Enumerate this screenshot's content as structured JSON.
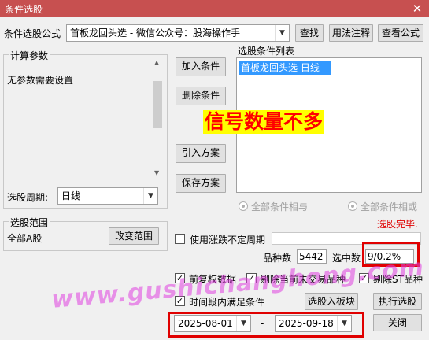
{
  "window": {
    "title": "条件选股",
    "close": "✕"
  },
  "formula": {
    "label": "条件选股公式",
    "value": "首板龙回头选  -  微信公众号：股海操作手",
    "buttons": {
      "find": "查找",
      "usage": "用法注释",
      "view": "查看公式"
    }
  },
  "params": {
    "group_title": "计算参数",
    "text": "无参数需要设置"
  },
  "period": {
    "label": "选股周期:",
    "value": "日线"
  },
  "range": {
    "group_title": "选股范围",
    "value": "全部A股",
    "change_button": "改变范围"
  },
  "actions": {
    "add": "加入条件",
    "delete": "删除条件",
    "import": "引入方案",
    "save": "保存方案"
  },
  "conditions": {
    "title": "选股条件列表",
    "items": [
      "首板龙回头选  日线"
    ]
  },
  "overlay_text": "信号数量不多",
  "logic": {
    "and": "全部条件相与",
    "or": "全部条件相或"
  },
  "status": "选股完毕.",
  "uncertain_period": {
    "label": "使用涨跌不定周期",
    "checked": false
  },
  "counts": {
    "total_label": "品种数",
    "total": "5442",
    "selected_label": "选中数",
    "selected": "9/0.2%"
  },
  "options": {
    "prev_adjust": "前复权数据",
    "exclude_untraded": "剔除当前未交易品种",
    "exclude_st": "剔除ST品种",
    "time_range": "时间段内满足条件"
  },
  "watermark": "www.gushichanghong.com",
  "bottom_buttons": {
    "to_block": "选股入板块",
    "run": "执行选股",
    "close": "关闭"
  },
  "dates": {
    "start": "2025-08-01",
    "dash": "-",
    "end": "2025-09-18"
  },
  "colors": {
    "accent_red": "#e00000",
    "selection_blue": "#3399ff",
    "overlay_yellow": "#ffff00",
    "watermark_magenta": "#e040e0"
  }
}
